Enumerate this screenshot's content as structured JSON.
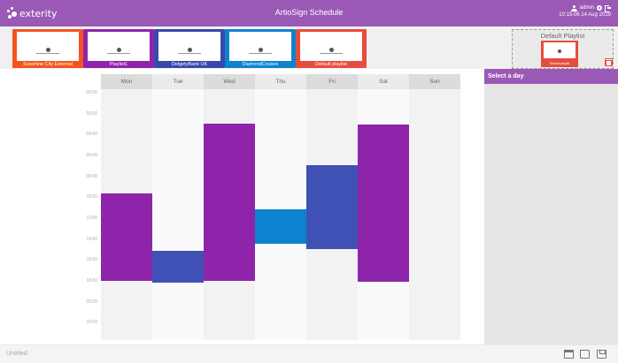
{
  "header": {
    "logo_text": "exterity",
    "title": "ArtioSign Schedule",
    "user": "admin",
    "datetime": "10:15:06 14 Aug 2019",
    "accent": "#9b59b6"
  },
  "playlists": [
    {
      "label": "Sunshine City External",
      "color": "#f3541f"
    },
    {
      "label": "Playlist1",
      "color": "#8e24aa"
    },
    {
      "label": "DelgetyBank UK",
      "color": "#3949ab"
    },
    {
      "label": "DiamondCruises",
      "color": "#0d83cf"
    },
    {
      "label": "Default playlist",
      "color": "#e74c3c"
    }
  ],
  "default_playlist": {
    "title": "Default Playlist",
    "card_label": "Default playlist",
    "delete_icon": "trash-icon"
  },
  "days": [
    "Mon",
    "Tue",
    "Wed",
    "Thu",
    "Fri",
    "Sat",
    "Sun"
  ],
  "times": [
    "00:00",
    "02:00",
    "04:00",
    "06:00",
    "08:00",
    "10:00",
    "12:00",
    "14:00",
    "16:00",
    "18:00",
    "20:00",
    "22:00"
  ],
  "schedule_blocks": [
    {
      "day": "Mon",
      "start": 10.0,
      "end": 18.3,
      "color": "#8e24aa"
    },
    {
      "day": "Tue",
      "start": 15.5,
      "end": 18.5,
      "color": "#3f51b5"
    },
    {
      "day": "Wed",
      "start": 3.3,
      "end": 18.3,
      "color": "#8e24aa"
    },
    {
      "day": "Thu",
      "start": 11.5,
      "end": 14.8,
      "color": "#0d83cf"
    },
    {
      "day": "Fri",
      "start": 7.3,
      "end": 15.3,
      "color": "#3f51b5"
    },
    {
      "day": "Sat",
      "start": 3.4,
      "end": 18.4,
      "color": "#8e24aa"
    }
  ],
  "panel": {
    "title": "Select a day"
  },
  "footer": {
    "file_name": "Untitled",
    "icons": [
      "calendar-icon",
      "folder-open-icon",
      "save-icon"
    ]
  }
}
